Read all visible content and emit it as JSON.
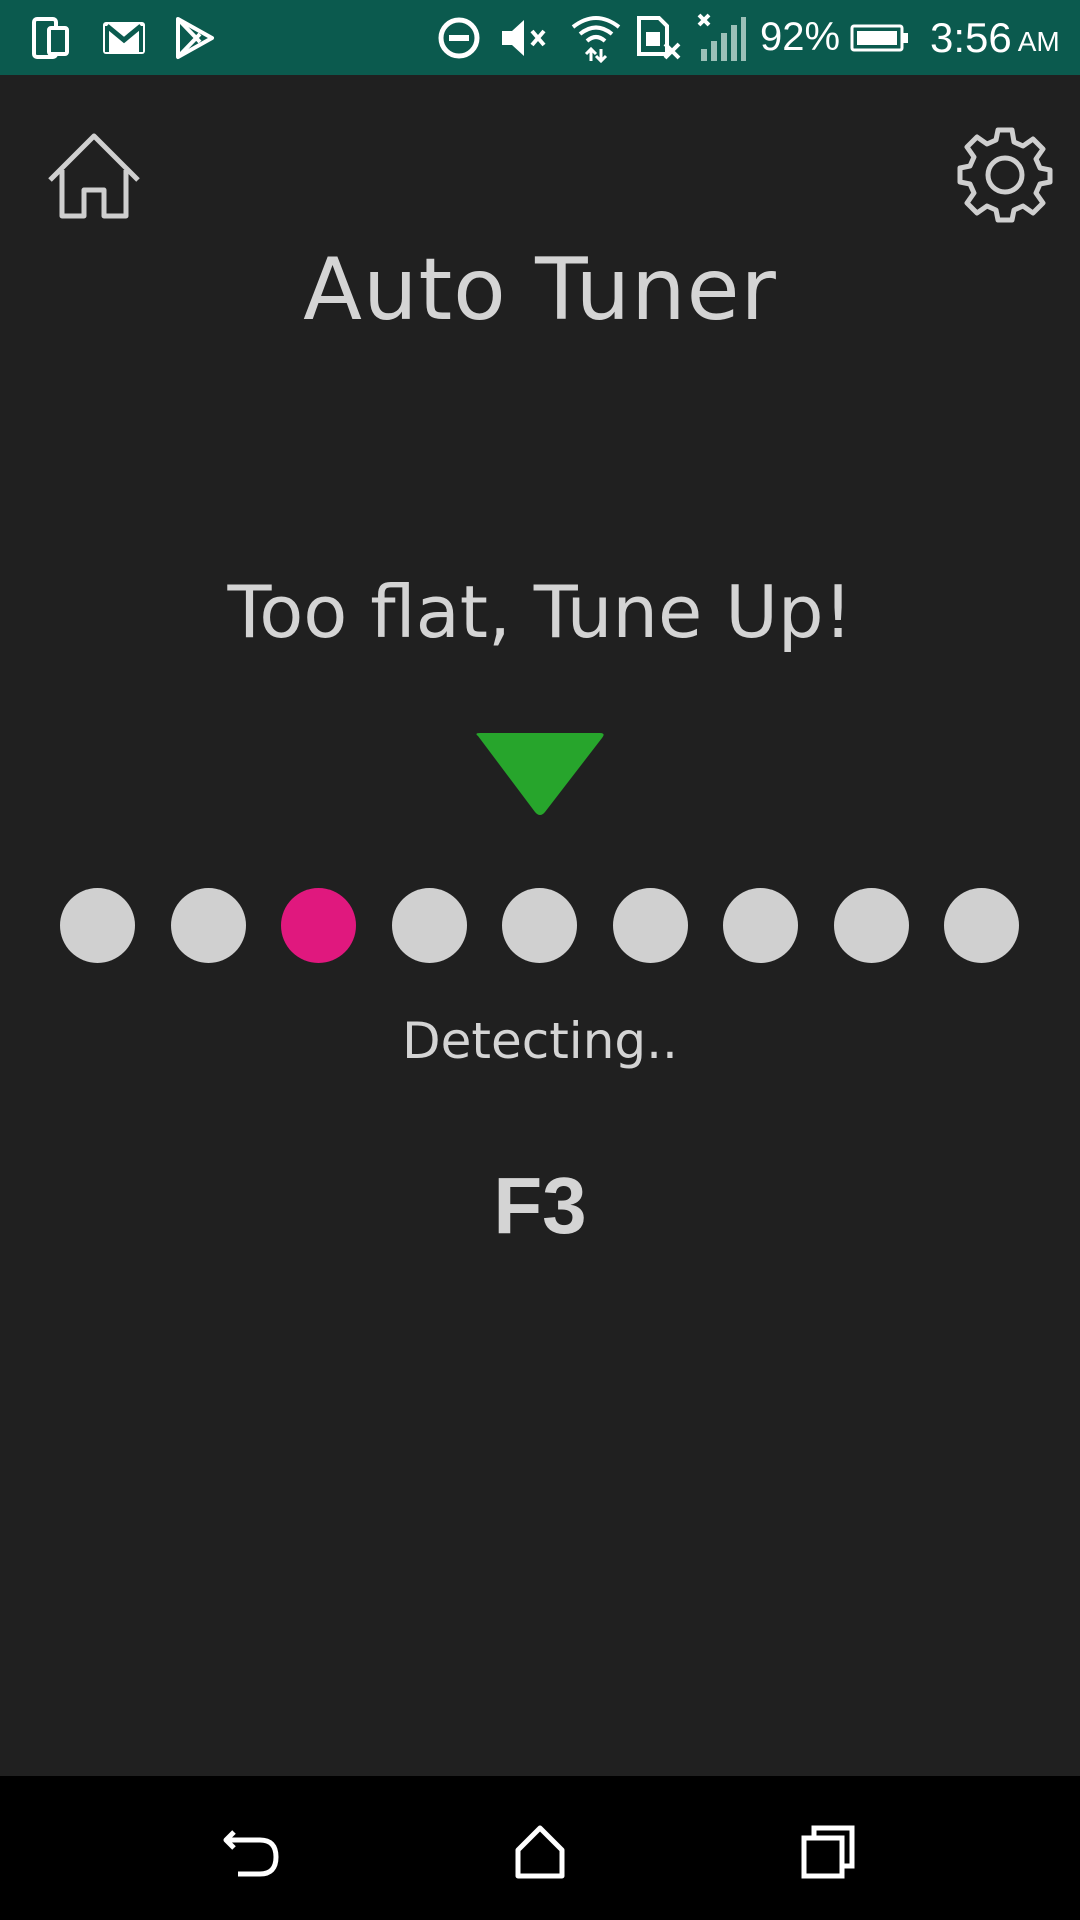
{
  "status_bar": {
    "battery_percent": "92%",
    "time": "3:56",
    "ampm": "AM",
    "icons": [
      "notification-phone-icon",
      "gmail-icon",
      "play-store-icon",
      "do-not-disturb-icon",
      "mute-icon",
      "wifi-icon",
      "no-sim-icon",
      "signal-icon",
      "battery-icon"
    ]
  },
  "header": {
    "title": "Auto Tuner",
    "home_icon": "home-icon",
    "settings_icon": "gear-icon"
  },
  "tuner": {
    "message": "Too flat, Tune Up!",
    "pointer_color": "#27a52c",
    "dot_count": 9,
    "active_dot_index": 2,
    "active_color": "#e0187e",
    "inactive_color": "#d0d0d0",
    "detecting_label": "Detecting..",
    "note": "F3"
  },
  "nav_bar": {
    "icons": [
      "back-icon",
      "home-nav-icon",
      "recents-icon"
    ]
  }
}
